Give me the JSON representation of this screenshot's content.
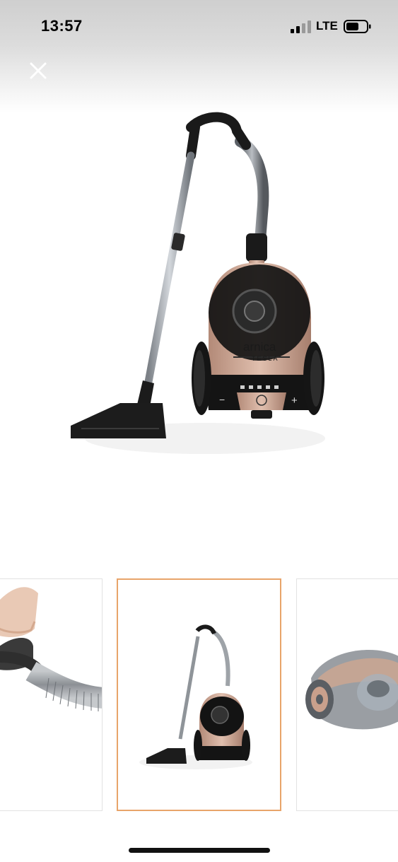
{
  "status_bar": {
    "time": "13:57",
    "network": "LTE",
    "signal_icon": "cellular-signal-icon",
    "battery_icon": "battery-icon"
  },
  "viewer": {
    "close_icon": "close-icon",
    "main_image": {
      "brand_text": "arnica",
      "model_text": "TESLA",
      "type": "product-photo-vacuum-cleaner"
    },
    "thumbnails": [
      {
        "kind": "hand-holding-hose-handle",
        "selected": false
      },
      {
        "kind": "full-vacuum-cleaner",
        "selected": true
      },
      {
        "kind": "vacuum-body-angled",
        "selected": false
      }
    ]
  },
  "colors": {
    "selected_border": "#e8a46a",
    "rose_gold": "#c9a08c",
    "body_black": "#151515"
  }
}
